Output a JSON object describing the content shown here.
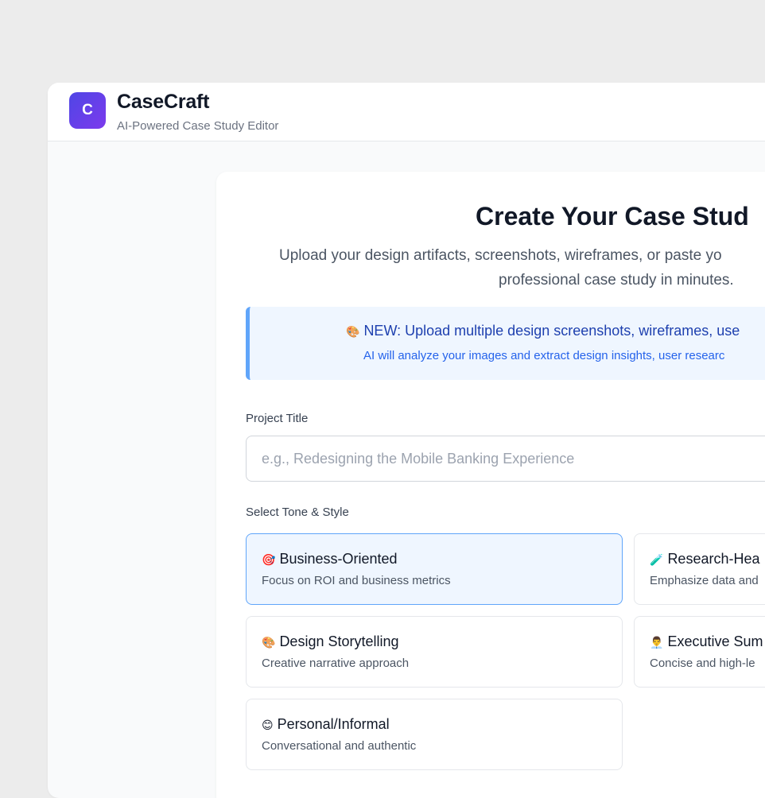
{
  "app": {
    "logo_letter": "C",
    "name": "CaseCraft",
    "tagline": "AI-Powered Case Study Editor"
  },
  "main": {
    "title": "Create Your Case Stud",
    "subtitle_line1": "Upload your design artifacts, screenshots, wireframes, or paste yo",
    "subtitle_line2": "professional case study in minutes."
  },
  "banner": {
    "icon": "🎨",
    "title": "NEW: Upload multiple design screenshots, wireframes, use",
    "subtitle": "AI will analyze your images and extract design insights, user researc"
  },
  "form": {
    "project_title_label": "Project Title",
    "project_title_placeholder": "e.g., Redesigning the Mobile Banking Experience",
    "project_title_value": "",
    "tone_label": "Select Tone & Style"
  },
  "tones": [
    {
      "icon": "🎯",
      "title": "Business-Oriented",
      "desc": "Focus on ROI and business metrics",
      "selected": true
    },
    {
      "icon": "🧪",
      "title": "Research-Hea",
      "desc": "Emphasize data and"
    },
    {
      "icon": "🎨",
      "title": "Design Storytelling",
      "desc": "Creative narrative approach"
    },
    {
      "icon": "👨‍💼",
      "title": "Executive Sum",
      "desc": "Concise and high-le"
    },
    {
      "icon": "😊",
      "title": "Personal/Informal",
      "desc": "Conversational and authentic"
    }
  ],
  "colors": {
    "accent": "#4f46e5",
    "selected_bg": "#eff6ff",
    "selected_border": "#60a5fa",
    "banner_text": "#1e40af"
  }
}
